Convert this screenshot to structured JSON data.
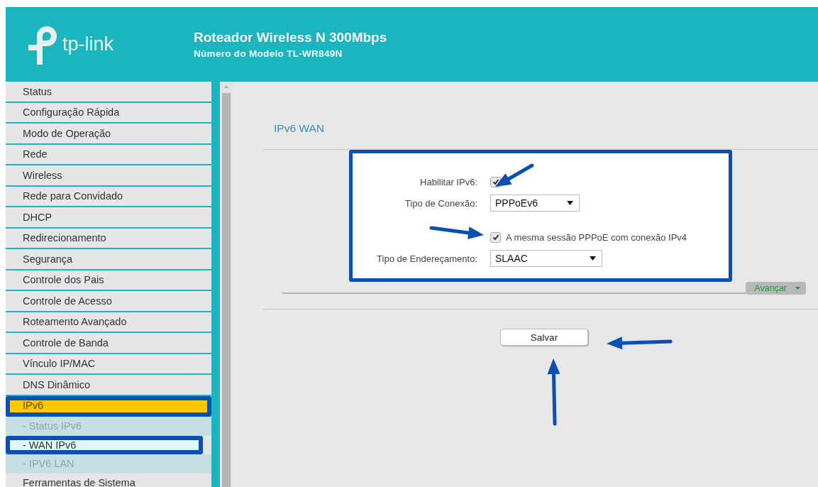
{
  "header": {
    "logo_text": "tp-link",
    "title": "Roteador Wireless N 300Mbps",
    "subtitle": "Número do Modelo TL-WR849N"
  },
  "sidebar": {
    "items": [
      {
        "label": "Status",
        "kind": "main",
        "selected": false,
        "highlighted": false
      },
      {
        "label": "Configuração Rápida",
        "kind": "main",
        "selected": false,
        "highlighted": false
      },
      {
        "label": "Modo de Operação",
        "kind": "main",
        "selected": false,
        "highlighted": false
      },
      {
        "label": "Rede",
        "kind": "main",
        "selected": false,
        "highlighted": false
      },
      {
        "label": "Wireless",
        "kind": "main",
        "selected": false,
        "highlighted": false
      },
      {
        "label": "Rede para Convidado",
        "kind": "main",
        "selected": false,
        "highlighted": false
      },
      {
        "label": "DHCP",
        "kind": "main",
        "selected": false,
        "highlighted": false
      },
      {
        "label": "Redirecionamento",
        "kind": "main",
        "selected": false,
        "highlighted": false
      },
      {
        "label": "Segurança",
        "kind": "main",
        "selected": false,
        "highlighted": false
      },
      {
        "label": "Controle dos Pais",
        "kind": "main",
        "selected": false,
        "highlighted": false
      },
      {
        "label": "Controle de Acesso",
        "kind": "main",
        "selected": false,
        "highlighted": false
      },
      {
        "label": "Roteamento Avançado",
        "kind": "main",
        "selected": false,
        "highlighted": false
      },
      {
        "label": "Controle de Banda",
        "kind": "main",
        "selected": false,
        "highlighted": false
      },
      {
        "label": "Vínculo IP/MAC",
        "kind": "main",
        "selected": false,
        "highlighted": false
      },
      {
        "label": "DNS Dinâmico",
        "kind": "main",
        "selected": false,
        "highlighted": false
      },
      {
        "label": "IPv6",
        "kind": "main",
        "selected": true,
        "highlighted": true
      },
      {
        "label": "- Status IPv6",
        "kind": "sub",
        "selected": false,
        "highlighted": false
      },
      {
        "label": "- WAN IPv6",
        "kind": "sub",
        "selected": true,
        "highlighted": true
      },
      {
        "label": "- IPV6 LAN",
        "kind": "sub",
        "selected": false,
        "highlighted": false
      },
      {
        "label": "Ferramentas de Sistema",
        "kind": "main",
        "selected": false,
        "highlighted": false
      }
    ]
  },
  "page": {
    "title": "IPv6 WAN",
    "form": {
      "highlighted": true,
      "rows": [
        {
          "kind": "checkbox",
          "label": "Habilitar IPv6:",
          "checked": true
        },
        {
          "kind": "select",
          "label": "Tipo de Conexão:",
          "value": "PPPoEv6"
        },
        {
          "kind": "option",
          "text": "A mesma sessão PPPoE com conexão IPv4",
          "checked": true
        },
        {
          "kind": "select",
          "label": "Tipo de Endereçamento:",
          "value": "SLAAC"
        }
      ]
    },
    "advanced_toggle": "Avançar",
    "save_button": "Salvar"
  }
}
